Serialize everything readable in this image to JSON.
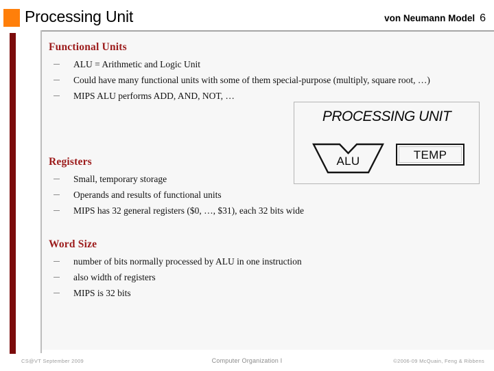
{
  "header": {
    "title": "Processing Unit",
    "subtitle": "von Neumann Model",
    "slide_number": "6",
    "accent_square_color": "#FF7F0A"
  },
  "theme": {
    "left_bar_color": "#7B0B0B",
    "heading_color": "#9C1B1B",
    "panel_bg": "#F7F7F7",
    "rule_color": "#A6A6A6"
  },
  "sections": [
    {
      "heading": "Functional Units",
      "bullets": [
        "ALU = Arithmetic and Logic Unit",
        "Could have many functional units with some of them special-purpose (multiply, square root, …)",
        "MIPS ALU performs ADD, AND, NOT, …"
      ]
    },
    {
      "heading": "Registers",
      "bullets": [
        "Small, temporary storage",
        "Operands and results of functional units",
        "MIPS has 32 general registers ($0, …, $31), each 32 bits wide"
      ]
    },
    {
      "heading": "Word Size",
      "bullets": [
        "number of bits normally processed by ALU in one instruction",
        "also width of registers",
        "MIPS is 32 bits"
      ]
    }
  ],
  "diagram": {
    "title": "PROCESSING UNIT",
    "alu_label": "ALU",
    "temp_label": "TEMP"
  },
  "footer": {
    "left": "CS@VT September 2009",
    "center": "Computer Organization I",
    "right": "©2006-09  McQuain, Feng & Ribbens"
  }
}
